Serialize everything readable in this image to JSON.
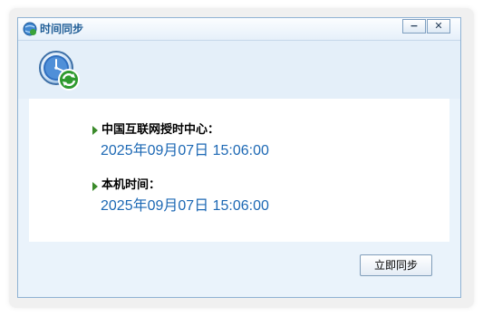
{
  "window": {
    "title": "时间同步",
    "minimize_symbol": "−",
    "close_symbol": "✕"
  },
  "icons": {
    "title_icon": "globe-sync-icon",
    "header_icon": "clock-sync-icon"
  },
  "rows": [
    {
      "label": "中国互联网授时中心：",
      "value": "2025年09月07日 15:06:00"
    },
    {
      "label": "本机时间：",
      "value": "2025年09月07日 15:06:00"
    }
  ],
  "footer": {
    "sync_button_label": "立即同步"
  },
  "colors": {
    "accent": "#1c68b4",
    "title": "#1f5d96",
    "arrow": "#3a8a2a"
  }
}
